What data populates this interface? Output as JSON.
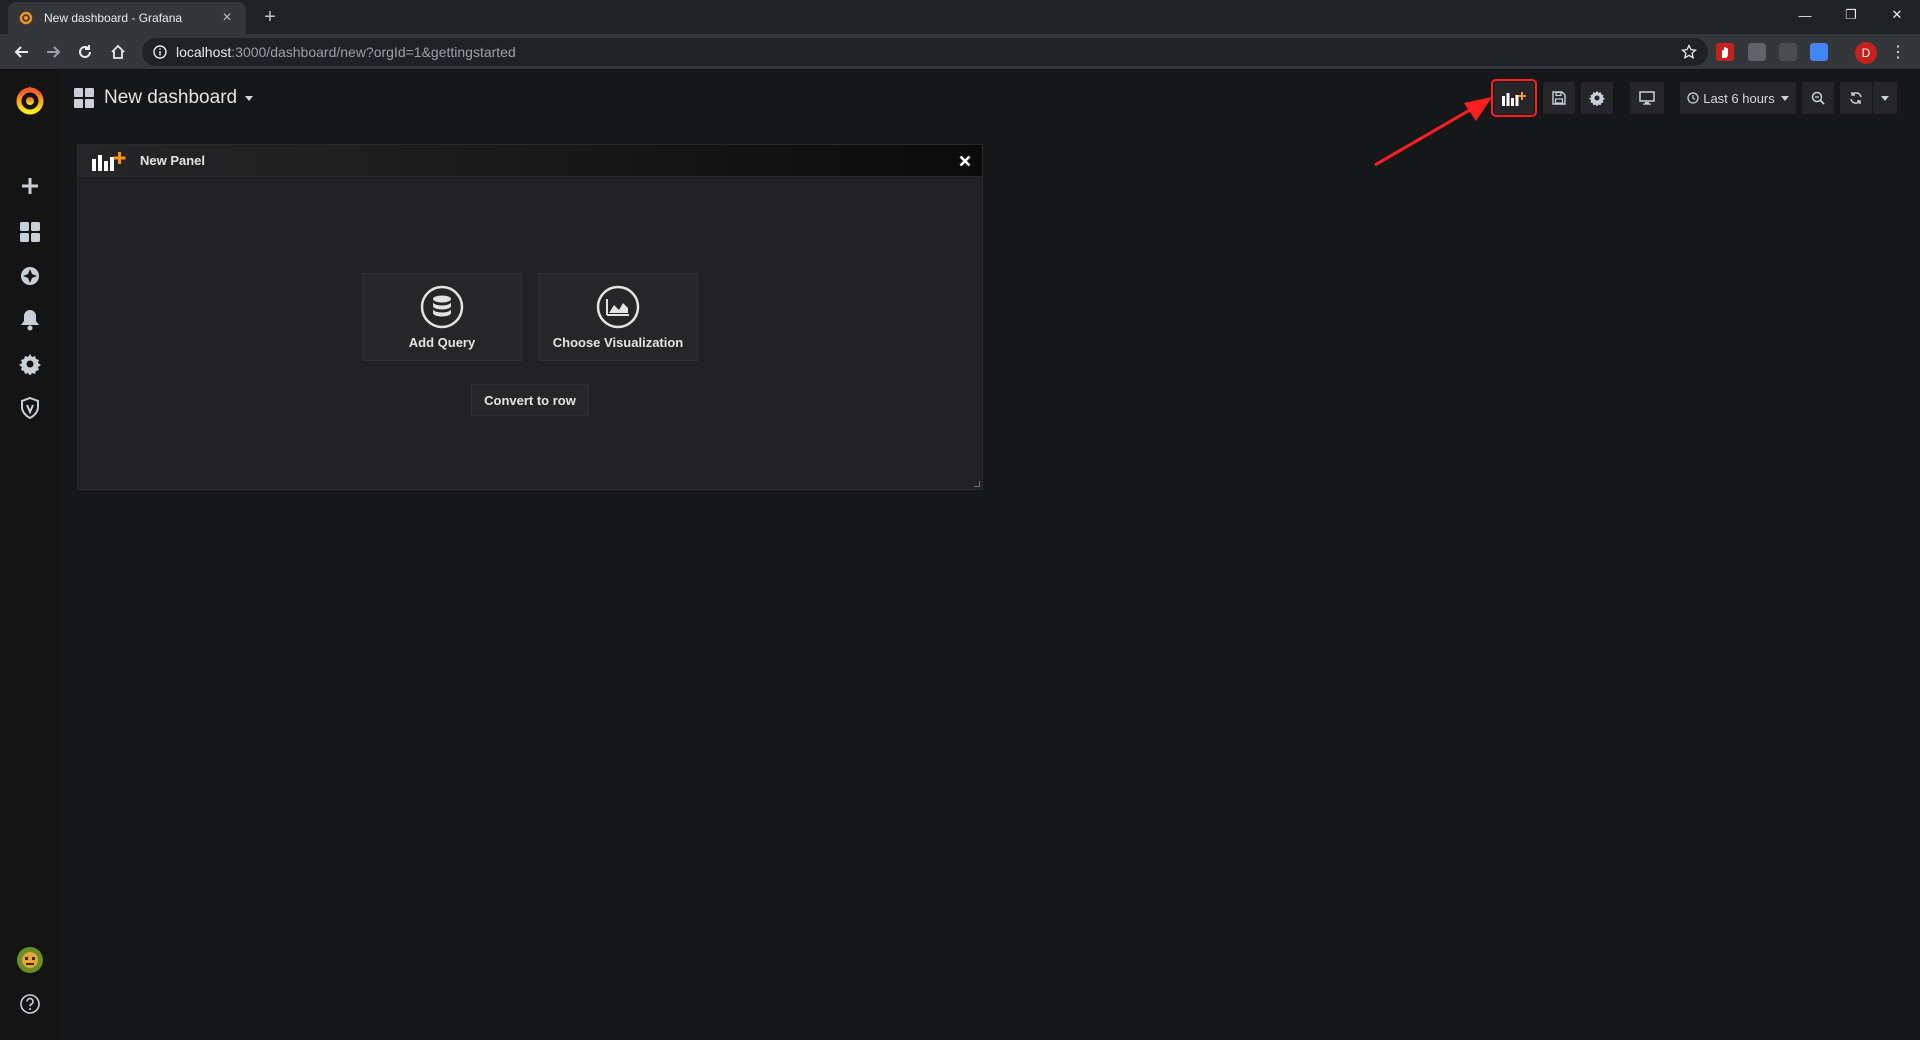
{
  "browser": {
    "tab_title": "New dashboard - Grafana",
    "url_host": "localhost",
    "url_rest": ":3000/dashboard/new?orgId=1&gettingstarted",
    "profile_initial": "D"
  },
  "sidebar": {
    "items": [
      "create-icon",
      "dashboards-icon",
      "explore-icon",
      "alerting-icon",
      "configuration-icon",
      "server-admin-icon"
    ],
    "bottom": [
      "user-avatar",
      "help-icon"
    ]
  },
  "dashboard": {
    "title": "New dashboard",
    "time_range": "Last 6 hours"
  },
  "panel": {
    "title": "New Panel",
    "add_query": "Add Query",
    "choose_visualization": "Choose Visualization",
    "convert_to_row": "Convert to row"
  },
  "colors": {
    "highlight": "#ff1f1f",
    "grafana_orange": "#f7931e",
    "background": "#161719"
  }
}
